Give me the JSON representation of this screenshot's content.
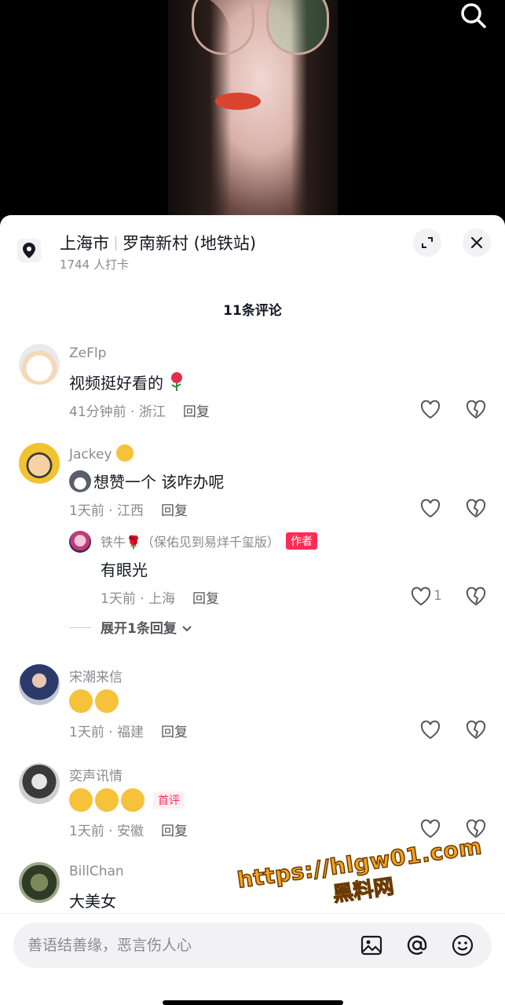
{
  "location": {
    "city": "上海市",
    "place": "罗南新村 (地铁站)",
    "checkins": "1744 人打卡"
  },
  "comment_count": "11条评论",
  "comments": [
    {
      "name": "ZeFlp",
      "text": "视频挺好看的",
      "emoji": "rose",
      "meta": "41分钟前 · 浙江",
      "reply": "回复"
    },
    {
      "name": "Jackey",
      "name_emoji": "smiling-face",
      "text": "想赞一个 该咋办呢",
      "emoji": "husky",
      "meta": "1天前 · 江西",
      "reply": "回复",
      "sub_reply": {
        "name": "铁牛🌹（保佑见到易烊千玺版）",
        "tag": "作者",
        "text": "有眼光",
        "meta": "1天前 · 上海",
        "reply": "回复",
        "likes": "1"
      },
      "expand": "展开1条回复"
    },
    {
      "name": "宋潮来信",
      "text": "",
      "emoji": "heart-eyes x2",
      "meta": "1天前 · 福建",
      "reply": "回复"
    },
    {
      "name": "奕声讯情",
      "text": "",
      "emoji": "grin x3",
      "tag": "首评",
      "meta": "1天前 · 安徽",
      "reply": "回复"
    },
    {
      "name": "BillChan",
      "text": "大美女"
    }
  ],
  "input": {
    "placeholder": "善语结善缘，恶言伤人心"
  },
  "watermark": {
    "url": "https://hlgw01.com",
    "name": "黑料网"
  },
  "colors": {
    "accent": "#fe2c55",
    "watermark": "#f7a21b"
  }
}
